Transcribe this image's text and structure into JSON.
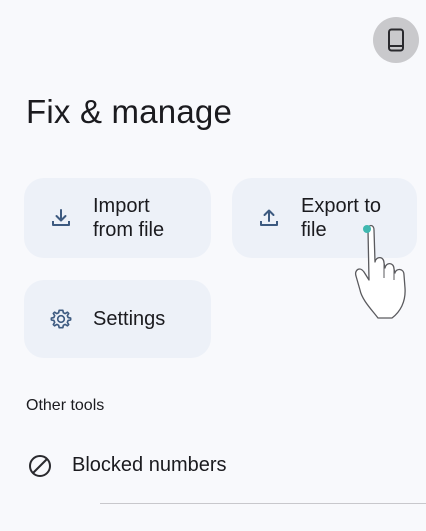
{
  "header": {
    "device_button_icon": "phone-device-icon"
  },
  "page": {
    "title": "Fix & manage"
  },
  "cards": {
    "import": {
      "label": "Import\nfrom file",
      "icon": "download-icon"
    },
    "export": {
      "label": "Export to\nfile",
      "icon": "upload-icon"
    },
    "settings": {
      "label": "Settings",
      "icon": "gear-icon"
    }
  },
  "other_tools": {
    "heading": "Other tools",
    "items": [
      {
        "label": "Blocked numbers",
        "icon": "block-icon"
      }
    ]
  },
  "colors": {
    "card_bg": "#edf1f8",
    "icon_accent": "#3d5a80",
    "text": "#1b1b1f",
    "touch_dot": "#3fb8b0"
  }
}
